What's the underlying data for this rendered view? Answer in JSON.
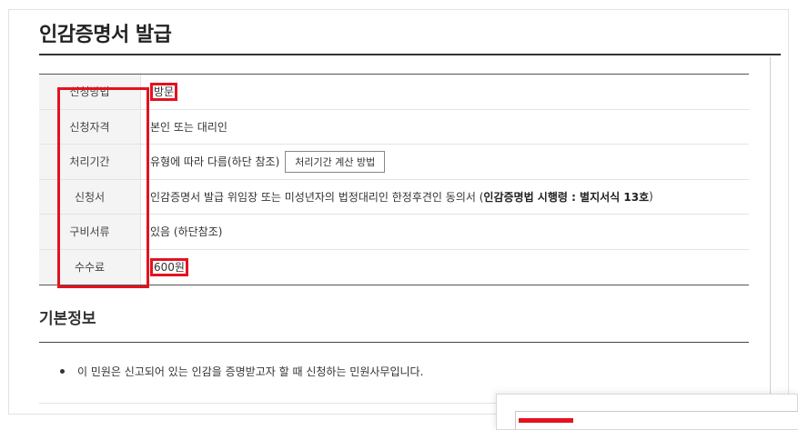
{
  "page": {
    "title": "인감증명서 발급"
  },
  "info_table": {
    "rows": [
      {
        "label": "신청방법",
        "value": "방문"
      },
      {
        "label": "신청자격",
        "value": "본인 또는 대리인"
      },
      {
        "label": "처리기간",
        "value": "유형에 따라 다름(하단 참조)",
        "button_label": "처리기간 계산 방법"
      },
      {
        "label": "신청서",
        "value_prefix": "인감증명서 발급 위임장 또는 미성년자의 법정대리인 한정후견인 동의서 (",
        "value_bold": "인감증명법 시행령 : 별지서식 13호",
        "value_suffix": ")"
      },
      {
        "label": "구비서류",
        "value": "있음 (하단참조)"
      },
      {
        "label": "수수료",
        "value": "600원"
      }
    ]
  },
  "basic_info": {
    "title": "기본정보",
    "items": [
      "이 민원은 신고되어 있는 인감을 증명받고자 할 때 신청하는 민원사무입니다."
    ]
  },
  "colors": {
    "highlight": "#e5121f",
    "header_bg": "#f4f4f4"
  }
}
